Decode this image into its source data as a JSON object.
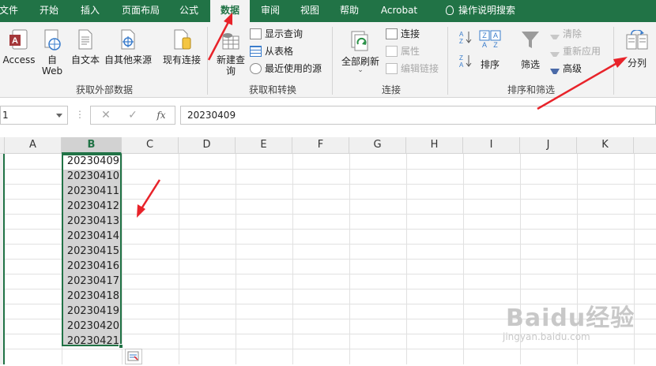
{
  "tabs": [
    "文件",
    "开始",
    "插入",
    "页面布局",
    "公式",
    "数据",
    "审阅",
    "视图",
    "帮助",
    "Acrobat",
    "操作说明搜索"
  ],
  "active_tab": "数据",
  "ribbon": {
    "ext_data": {
      "access": "Access",
      "web": "自\nWeb",
      "web_line1": "自",
      "web_line2": "Web",
      "text": "自文本",
      "other": "自其他来源",
      "existing": "现有连接",
      "group_label": "获取外部数据"
    },
    "transform": {
      "new_query_line1": "新建查",
      "new_query_line2": "询",
      "show_queries": "显示查询",
      "from_table": "从表格",
      "recent_sources": "最近使用的源",
      "group_label": "获取和转换"
    },
    "connections": {
      "refresh_all": "全部刷新",
      "connections": "连接",
      "properties": "属性",
      "edit_links": "编辑链接",
      "group_label": "连接"
    },
    "sort_filter": {
      "sort": "排序",
      "filter": "筛选",
      "clear": "清除",
      "reapply": "重新应用",
      "advanced": "高级",
      "group_label": "排序和筛选"
    },
    "data_tools": {
      "text_to_columns": "分列"
    }
  },
  "formula_bar": {
    "name_box": "1",
    "cancel": "✕",
    "enter": "✓",
    "fx": "fx",
    "value": "20230409"
  },
  "grid": {
    "columns": [
      "A",
      "B",
      "C",
      "D",
      "E",
      "F",
      "G",
      "H",
      "I",
      "J",
      "K"
    ],
    "selected_column": "B",
    "cells_B": [
      "20230409",
      "20230410",
      "20230411",
      "20230412",
      "20230413",
      "20230414",
      "20230415",
      "20230416",
      "20230417",
      "20230418",
      "20230419",
      "20230420",
      "20230421"
    ]
  },
  "watermark": {
    "line1": "Baidu经验",
    "line2": "jingyan.baidu.com"
  },
  "colors": {
    "excel_green": "#217346",
    "annotation_red": "#e8232a",
    "selection_gray": "#d3d3d3"
  }
}
